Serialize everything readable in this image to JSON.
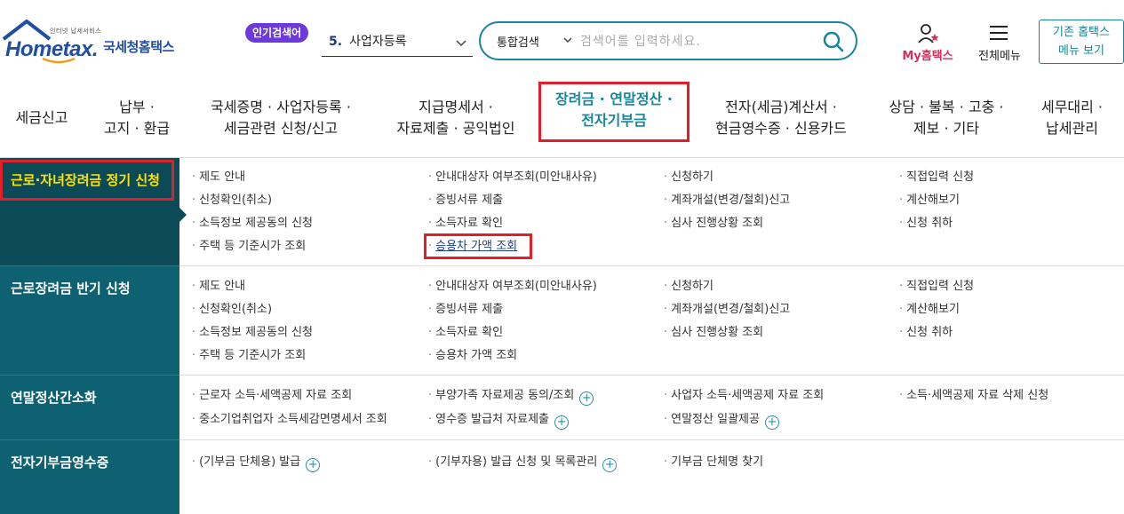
{
  "header": {
    "logo_small": "인터넷 납세서비스",
    "logo_main": "Hometax.",
    "logo_kr": "국세청홈택스",
    "popular_badge": "인기검색어",
    "popular_rank": "5.",
    "popular_term": "사업자등록",
    "search_category": "통합검색",
    "search_placeholder": "검색어를 입력하세요.",
    "my_hometax": "My홈택스",
    "all_menu": "전체메뉴",
    "old_home_line1": "기존 홈택스",
    "old_home_line2": "메뉴 보기"
  },
  "gnb": [
    {
      "label": "세금신고"
    },
    {
      "label": "납부 ·\n고지 · 환급"
    },
    {
      "label": "국세증명 · 사업자등록 ·\n세금관련 신청/신고"
    },
    {
      "label": "지급명세서 ·\n자료제출 · 공익법인"
    },
    {
      "label": "장려금 · 연말정산 ·\n전자기부금"
    },
    {
      "label": "전자(세금)계산서 ·\n현금영수증 · 신용카드"
    },
    {
      "label": "상담 · 불복 · 고충 ·\n제보 · 기타"
    },
    {
      "label": "세무대리 ·\n납세관리"
    }
  ],
  "side": [
    {
      "label": "근로·자녀장려금 정기 신청"
    },
    {
      "label": "근로장려금 반기 신청"
    },
    {
      "label": "연말정산간소화"
    },
    {
      "label": "전자기부금영수증"
    }
  ],
  "groups": [
    {
      "items": [
        "제도 안내",
        "안내대상자 여부조회(미안내사유)",
        "신청하기",
        "직접입력 신청",
        "신청확인(취소)",
        "증빙서류 제출",
        "계좌개설(변경/철회)신고",
        "계산해보기",
        "소득정보 제공동의 신청",
        "소득자료 확인",
        "심사 진행상황 조회",
        "신청 취하",
        "주택 등 기준시가 조회",
        "승용차 가액 조회"
      ]
    },
    {
      "items": [
        "제도 안내",
        "안내대상자 여부조회(미안내사유)",
        "신청하기",
        "직접입력 신청",
        "신청확인(취소)",
        "증빙서류 제출",
        "계좌개설(변경/철회)신고",
        "계산해보기",
        "소득정보 제공동의 신청",
        "소득자료 확인",
        "심사 진행상황 조회",
        "신청 취하",
        "주택 등 기준시가 조회",
        "승용차 가액 조회"
      ]
    },
    {
      "items": [
        "근로자 소득·세액공제 자료 조회",
        "부양가족 자료제공 동의/조회",
        "사업자 소득·세액공제 자료 조회",
        "소득·세액공제 자료 삭제 신청",
        "중소기업취업자 소득세감면명세서 조회",
        "영수증 발급처 자료제출",
        "연말정산 일괄제공"
      ]
    },
    {
      "items": [
        "(기부금 단체용) 발급",
        "(기부자용) 발급 신청 및 목록관리",
        "기부금 단체명 찾기"
      ]
    }
  ],
  "colors": {
    "brand": "#1f4ea3",
    "accent": "#17859b",
    "side_bg": "#0e6170",
    "highlight": "#e01f26",
    "active_side_text": "#ffe200"
  }
}
